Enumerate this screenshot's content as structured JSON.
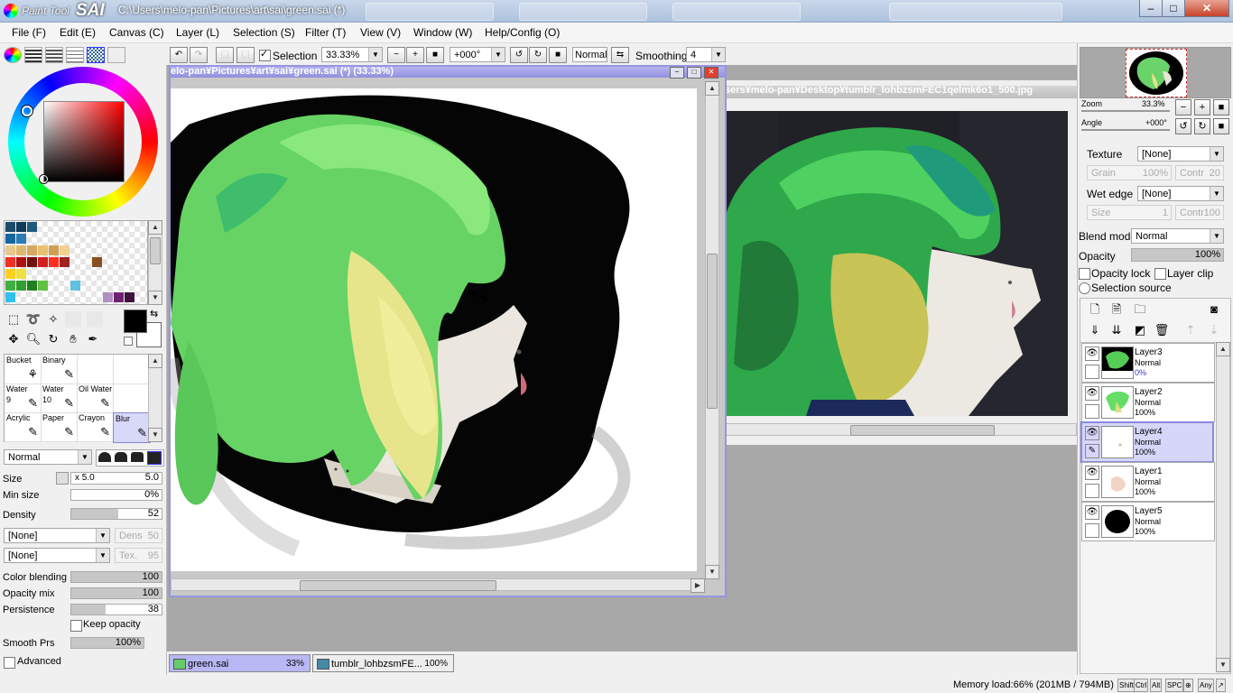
{
  "window": {
    "logo_small": "Paint Tool",
    "logo_big": "SAI",
    "title": "C:\\Users\\melo-pan\\Pictures\\art\\sai\\green.sai (*)",
    "controls": [
      "–",
      "□",
      "✕"
    ]
  },
  "menu": [
    "File (F)",
    "Edit (E)",
    "Canvas (C)",
    "Layer (L)",
    "Selection (S)",
    "Filter (T)",
    "View (V)",
    "Window (W)",
    "Help/Config (O)"
  ],
  "toolbar": {
    "selection_label": "Selection",
    "selection_checked": true,
    "zoom": "33.33%",
    "rotation": "+000°",
    "blend": "Normal",
    "smoothing_label": "Smoothing",
    "smoothing_value": "4"
  },
  "colors": {
    "accent": "#9090dd",
    "foreground": "#000000",
    "background": "#ffffff",
    "swatches": [
      [
        "#1b4a6b",
        "#0f3a5b",
        "#1e5a7c",
        "",
        "",
        "",
        "",
        "",
        "",
        "",
        "",
        "",
        ""
      ],
      [
        "#1565a0",
        "#2d7db4",
        "",
        "",
        "",
        "",
        "",
        "",
        "",
        "",
        "",
        "",
        ""
      ],
      [
        "#e8c98c",
        "#e0b870",
        "#d8a860",
        "#e8c070",
        "#d0a050",
        "#f0d090",
        "",
        "",
        "",
        "",
        "",
        "",
        ""
      ],
      [
        "#f03020",
        "#b01010",
        "#701010",
        "#d02020",
        "#ff3020",
        "#a02020",
        "",
        "",
        "#885020",
        "",
        "",
        "",
        ""
      ],
      [
        "#ffd020",
        "#f0e040",
        "",
        "",
        "",
        "",
        "",
        "",
        "",
        "",
        "",
        "",
        ""
      ],
      [
        "#40b040",
        "#30a030",
        "#208020",
        "#60c040",
        "",
        "",
        "#60c0e0",
        "",
        "",
        "",
        "",
        "",
        ""
      ],
      [
        "#30c0f0",
        "",
        "",
        "",
        "",
        "",
        "",
        "",
        "",
        "#b090c0",
        "#702070",
        "#401040",
        ""
      ]
    ]
  },
  "tools_row1": [
    "select-rect",
    "lasso",
    "magic-wand",
    "",
    "",
    ""
  ],
  "tools_row2": [
    "move",
    "zoom",
    "rotate",
    "hand",
    "eyedropper"
  ],
  "brushes": [
    {
      "name": "Bucket",
      "size": "",
      "icon": "⚘"
    },
    {
      "name": "Binary",
      "size": "",
      "icon": "✎"
    },
    {
      "name": "",
      "size": "",
      "icon": ""
    },
    {
      "name": "",
      "size": "",
      "icon": ""
    },
    {
      "name": "Water",
      "size": "9",
      "icon": "✎"
    },
    {
      "name": "Water",
      "size": "10",
      "icon": "✎"
    },
    {
      "name": "Oil Water",
      "size": "",
      "icon": "✎"
    },
    {
      "name": "",
      "size": "",
      "icon": ""
    },
    {
      "name": "Acrylic",
      "size": "",
      "icon": "✎"
    },
    {
      "name": "Paper",
      "size": "",
      "icon": "✎"
    },
    {
      "name": "Crayon",
      "size": "",
      "icon": "✎"
    },
    {
      "name": "Blur",
      "size": "",
      "icon": "✎"
    }
  ],
  "brush_settings": {
    "mode": "Normal",
    "size_label": "Size",
    "size_mult": "x 5.0",
    "size_value": "5.0",
    "minsize_label": "Min size",
    "minsize_value": "0%",
    "density_label": "Density",
    "density_value": "52",
    "density_fill": 0.52,
    "texture1": "[None]",
    "texture1_side": "Dens",
    "texture1_side_val": "50",
    "texture2": "[None]",
    "texture2_side": "Tex.",
    "texture2_side_val": "95",
    "color_blending_label": "Color blending",
    "color_blending_value": "100",
    "opacity_mix_label": "Opacity mix",
    "opacity_mix_value": "100",
    "persistence_label": "Persistence",
    "persistence_value": "38",
    "keep_opacity_label": "Keep opacity",
    "smooth_prs_label": "Smooth Prs",
    "smooth_prs_value": "100%",
    "advanced_label": "Advanced"
  },
  "doc1": {
    "title": "elo-pan¥Pictures¥art¥sai¥green.sai (*) (33.33%)"
  },
  "doc2": {
    "title": "sers¥melo-pan¥Desktop¥tumblr_lohbzsmFEC1qelmk6o1_500.jpg"
  },
  "tabs": [
    {
      "name": "green.sai",
      "zoom": "33%"
    },
    {
      "name": "tumblr_lohbzsmFE...",
      "zoom": "100%"
    }
  ],
  "navigator": {
    "zoom_label": "Zoom",
    "zoom_value": "33.3%",
    "angle_label": "Angle",
    "angle_value": "+000°"
  },
  "layer_props": {
    "texture_label": "Texture",
    "texture_value": "[None]",
    "grain_label": "Grain",
    "grain_value": "100%",
    "contr_label": "Contr",
    "contr_value": "20",
    "wetedge_label": "Wet edge",
    "wetedge_value": "[None]",
    "size_label": "Size",
    "size_value": "1",
    "contr2_value": "100",
    "blendmode_label": "Blend mode",
    "blendmode_value": "Normal",
    "opacity_label": "Opacity",
    "opacity_value": "100%",
    "opacity_lock": "Opacity lock",
    "layer_clip": "Layer clip",
    "selection_source": "Selection source"
  },
  "layers": [
    {
      "name": "Layer3",
      "mode": "Normal",
      "opacity": "0%",
      "selected": false
    },
    {
      "name": "Layer2",
      "mode": "Normal",
      "opacity": "100%",
      "selected": false
    },
    {
      "name": "Layer4",
      "mode": "Normal",
      "opacity": "100%",
      "selected": true
    },
    {
      "name": "Layer1",
      "mode": "Normal",
      "opacity": "100%",
      "selected": false
    },
    {
      "name": "Layer5",
      "mode": "Normal",
      "opacity": "100%",
      "selected": false
    }
  ],
  "status": {
    "memory": "Memory load:66% (201MB / 794MB)",
    "keys": [
      "Shift",
      "Ctrl",
      "Alt",
      "SPC",
      "⊕",
      "Any",
      "↗"
    ]
  }
}
